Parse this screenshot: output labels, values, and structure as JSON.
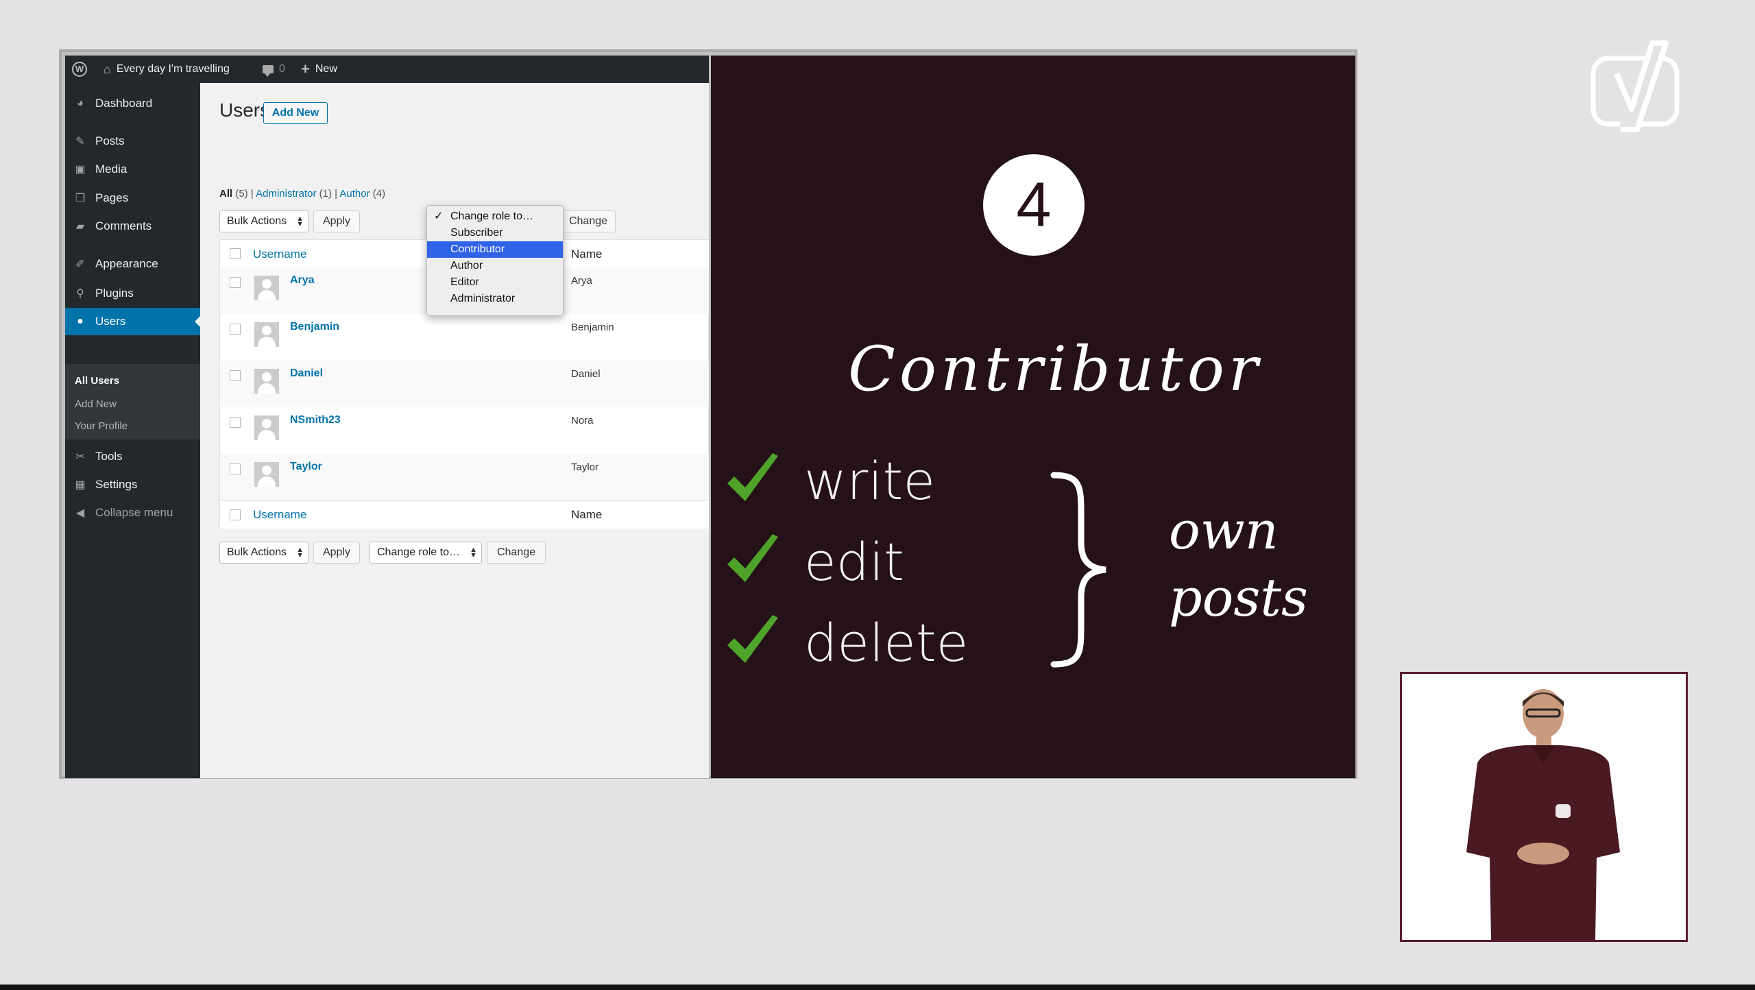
{
  "adminbar": {
    "site_name": "Every day I'm travelling",
    "comments_count": "0",
    "new_label": "New"
  },
  "sidebar": {
    "items": [
      {
        "label": "Dashboard",
        "icon": "dashboard-icon"
      },
      {
        "label": "Posts",
        "icon": "pin-icon"
      },
      {
        "label": "Media",
        "icon": "media-icon"
      },
      {
        "label": "Pages",
        "icon": "pages-icon"
      },
      {
        "label": "Comments",
        "icon": "comments-icon"
      },
      {
        "label": "Appearance",
        "icon": "brush-icon"
      },
      {
        "label": "Plugins",
        "icon": "plugin-icon"
      },
      {
        "label": "Users",
        "icon": "user-icon"
      },
      {
        "label": "Tools",
        "icon": "wrench-icon"
      },
      {
        "label": "Settings",
        "icon": "settings-icon"
      }
    ],
    "submenu": [
      "All Users",
      "Add New",
      "Your Profile"
    ],
    "collapse_label": "Collapse menu"
  },
  "content": {
    "title": "Users",
    "add_new_label": "Add New",
    "filters": {
      "all_label": "All",
      "all_count": "(5)",
      "admin_label": "Administrator",
      "admin_count": "(1)",
      "author_label": "Author",
      "author_count": "(4)",
      "separator": "|"
    },
    "bulk_actions_label": "Bulk Actions",
    "apply_label": "Apply",
    "change_role_label": "Change role to…",
    "change_label": "Change",
    "columns": {
      "username": "Username",
      "name": "Name"
    },
    "users": [
      {
        "username": "Arya",
        "name": "Arya"
      },
      {
        "username": "Benjamin",
        "name": "Benjamin"
      },
      {
        "username": "Daniel",
        "name": "Daniel"
      },
      {
        "username": "NSmith23",
        "name": "Nora"
      },
      {
        "username": "Taylor",
        "name": "Taylor"
      }
    ],
    "dropdown": {
      "options": [
        "Change role to…",
        "Subscriber",
        "Contributor",
        "Author",
        "Editor",
        "Administrator"
      ],
      "checked_index": 0,
      "highlighted_index": 2,
      "highlight_color": "#2f62e6"
    }
  },
  "slide": {
    "step_number": "4",
    "role": "Contributor",
    "permissions": [
      "write",
      "edit",
      "delete"
    ],
    "scope_line1": "own",
    "scope_line2": "posts",
    "check_color": "#4fa32a",
    "background_color": "#241218"
  },
  "branding": {
    "logo_icon": "yoast-logo-icon"
  },
  "presenter": {
    "icon": "presenter-video"
  }
}
